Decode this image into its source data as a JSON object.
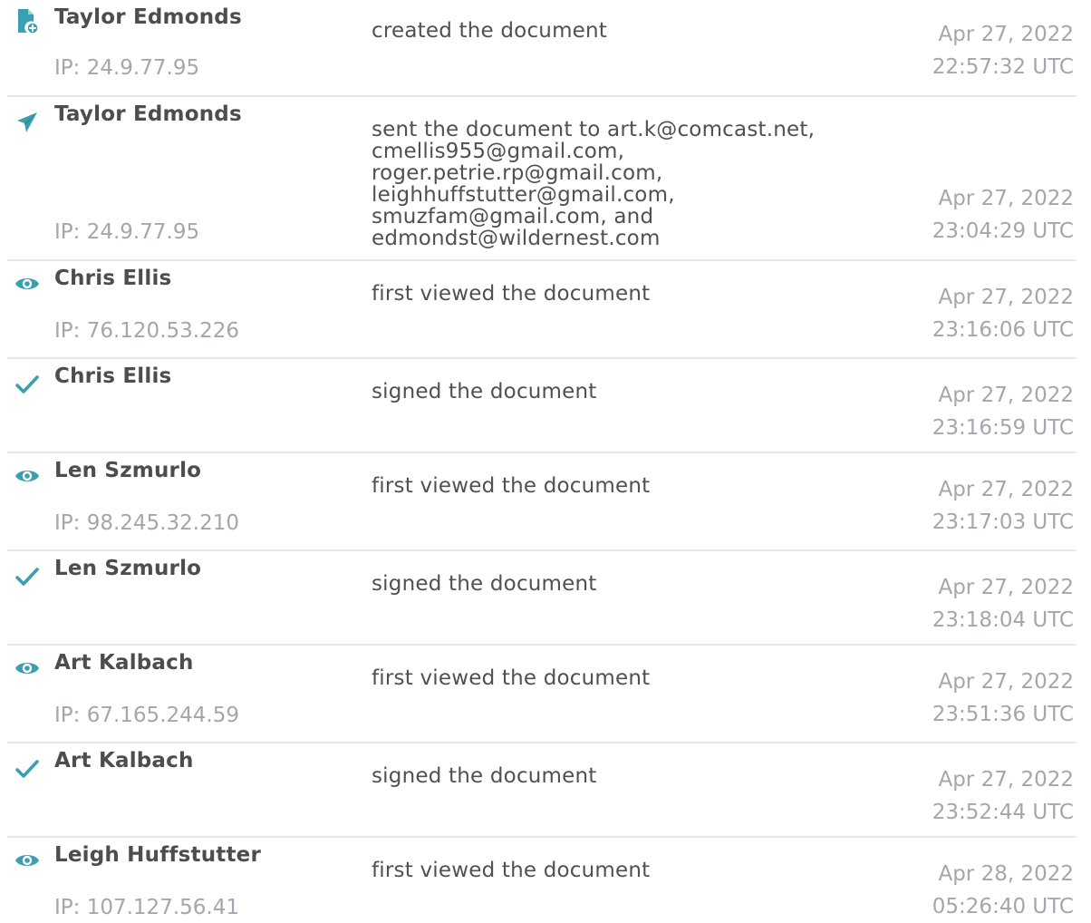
{
  "colors": {
    "accent": "#3a9fb0",
    "name_text": "#4d4d4d",
    "muted_text": "#a3a7ad",
    "divider": "#e6e8ea"
  },
  "events": [
    {
      "icon": "document-add-icon",
      "name": "Taylor Edmonds",
      "ip": "IP: 24.9.77.95",
      "action": "created the document",
      "date": "Apr 27, 2022",
      "time": "22:57:32 UTC"
    },
    {
      "icon": "send-icon",
      "name": "Taylor Edmonds",
      "ip": "IP: 24.9.77.95",
      "action": "sent the document to art.k@comcast.net, cmellis955@gmail.com, roger.petrie.rp@gmail.com, leighhuffstutter@gmail.com, smuzfam@gmail.com, and edmondst@wildernest.com",
      "date": "Apr 27, 2022",
      "time": "23:04:29 UTC"
    },
    {
      "icon": "eye-icon",
      "name": "Chris Ellis",
      "ip": "IP: 76.120.53.226",
      "action": "first viewed the document",
      "date": "Apr 27, 2022",
      "time": "23:16:06 UTC"
    },
    {
      "icon": "check-icon",
      "name": "Chris Ellis",
      "ip": "",
      "action": "signed the document",
      "date": "Apr 27, 2022",
      "time": "23:16:59 UTC"
    },
    {
      "icon": "eye-icon",
      "name": "Len Szmurlo",
      "ip": "IP: 98.245.32.210",
      "action": "first viewed the document",
      "date": "Apr 27, 2022",
      "time": "23:17:03 UTC"
    },
    {
      "icon": "check-icon",
      "name": "Len Szmurlo",
      "ip": "",
      "action": "signed the document",
      "date": "Apr 27, 2022",
      "time": "23:18:04 UTC"
    },
    {
      "icon": "eye-icon",
      "name": "Art Kalbach",
      "ip": "IP: 67.165.244.59",
      "action": "first viewed the document",
      "date": "Apr 27, 2022",
      "time": "23:51:36 UTC"
    },
    {
      "icon": "check-icon",
      "name": "Art Kalbach",
      "ip": "",
      "action": "signed the document",
      "date": "Apr 27, 2022",
      "time": "23:52:44 UTC"
    },
    {
      "icon": "eye-icon",
      "name": "Leigh Huffstutter",
      "ip": "IP: 107.127.56.41",
      "action": "first viewed the document",
      "date": "Apr 28, 2022",
      "time": "05:26:40 UTC"
    }
  ]
}
